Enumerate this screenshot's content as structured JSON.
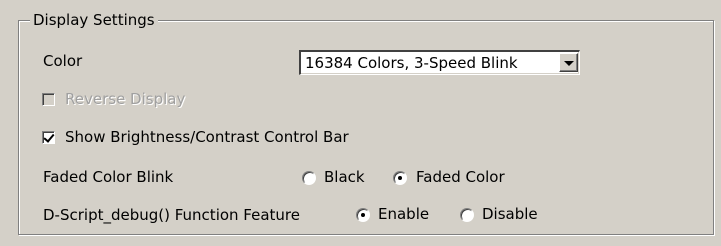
{
  "display_settings": {
    "title": "Display Settings",
    "color": {
      "label": "Color",
      "selected": "16384 Colors, 3-Speed Blink"
    },
    "reverse_display": {
      "label": "Reverse Display",
      "checked": false,
      "enabled": false
    },
    "show_brightness": {
      "label": "Show Brightness/Contrast Control Bar",
      "checked": true
    },
    "faded_color_blink": {
      "label": "Faded Color Blink",
      "options": [
        "Black",
        "Faded Color"
      ],
      "selected": "Faded Color"
    },
    "d_script_debug": {
      "label": "D-Script_debug() Function Feature",
      "options": [
        "Enable",
        "Disable"
      ],
      "selected": "Enable"
    }
  },
  "colors": {
    "face": "#d4d0c8",
    "disabled_text": "#a0a0a0"
  }
}
